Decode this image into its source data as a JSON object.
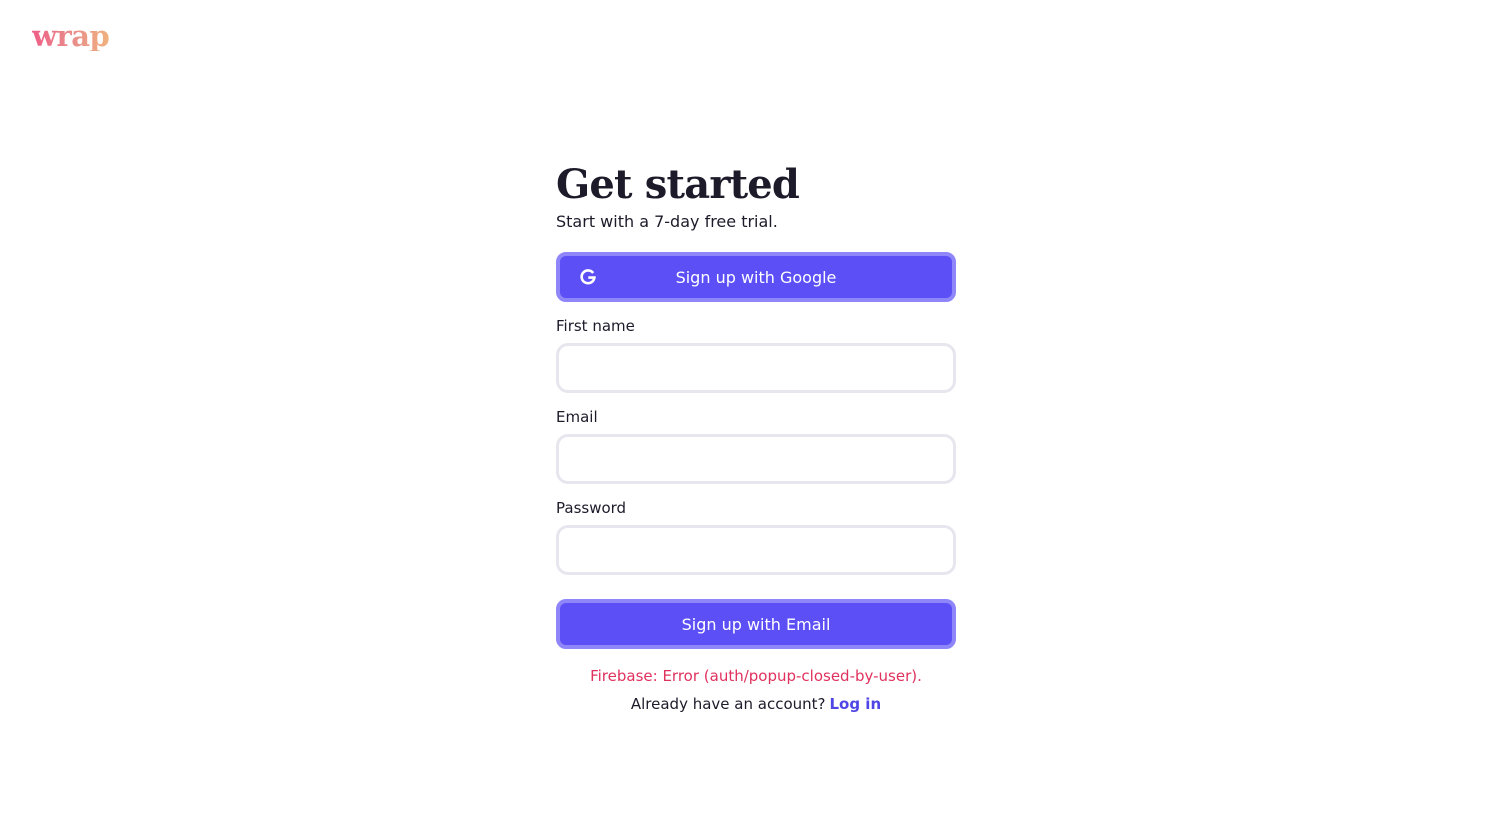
{
  "brand": {
    "logo_text": "wrap"
  },
  "form": {
    "title": "Get started",
    "subtitle": "Start with a 7-day free trial.",
    "google_button_label": "Sign up with Google",
    "fields": {
      "first_name": {
        "label": "First name",
        "value": "",
        "placeholder": ""
      },
      "email": {
        "label": "Email",
        "value": "",
        "placeholder": ""
      },
      "password": {
        "label": "Password",
        "value": "",
        "placeholder": ""
      }
    },
    "email_button_label": "Sign up with Email",
    "error_message": "Firebase: Error (auth/popup-closed-by-user).",
    "login_prompt": "Already have an account?",
    "login_link": "Log in"
  },
  "colors": {
    "primary": "#5b4ff5",
    "primary_border": "#8f86f9",
    "error": "#e0325e",
    "link": "#4f46e5",
    "input_border": "#e7e6ee"
  },
  "icons": {
    "google_button": "google-g-icon"
  }
}
